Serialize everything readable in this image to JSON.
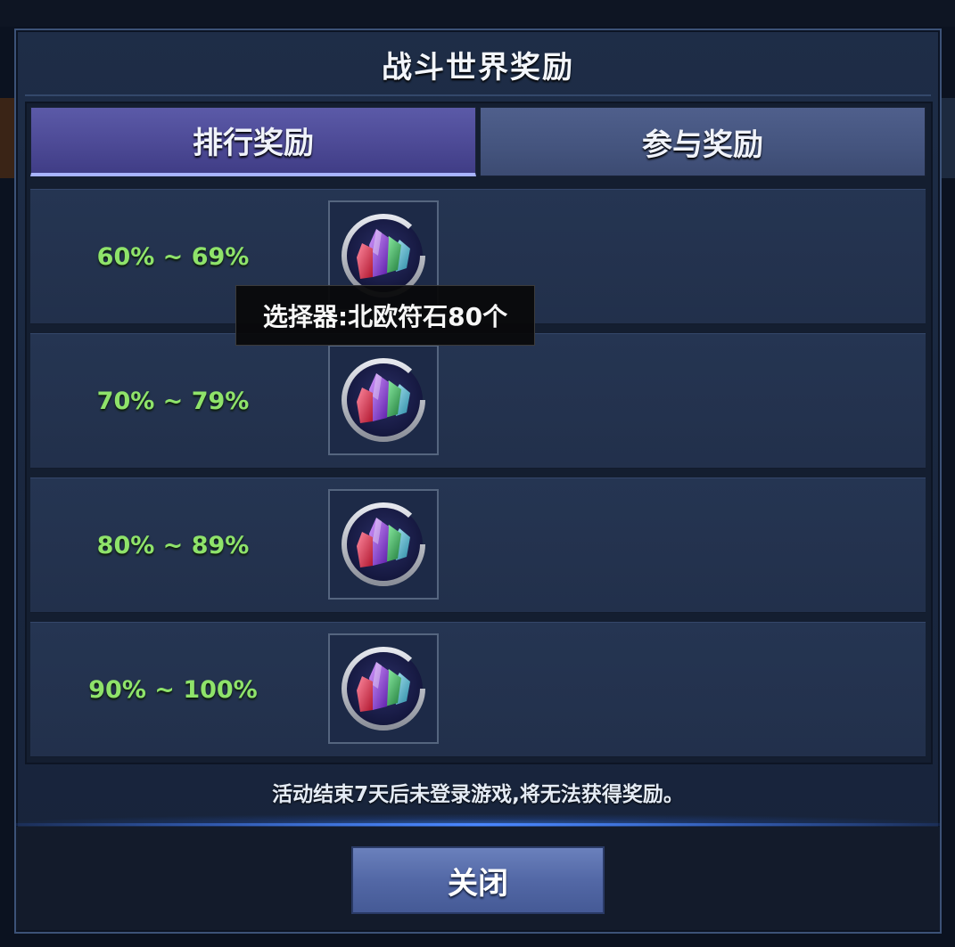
{
  "dialog": {
    "title": "战斗世界奖励",
    "tabs": [
      {
        "label": "排行奖励",
        "active": true
      },
      {
        "label": "参与奖励",
        "active": false
      }
    ],
    "rewards": [
      {
        "range": "60% ~ 69%",
        "item_icon": "rune-crystals-icon"
      },
      {
        "range": "70% ~ 79%",
        "item_icon": "rune-crystals-icon"
      },
      {
        "range": "80% ~ 89%",
        "item_icon": "rune-crystals-icon"
      },
      {
        "range": "90% ~ 100%",
        "item_icon": "rune-crystals-icon"
      }
    ],
    "tooltip": "选择器:北欧符石80个",
    "notice": "活动结束7天后未登录游戏,将无法获得奖励。",
    "close_label": "关闭"
  },
  "colors": {
    "range_text": "#8fe36a",
    "active_tab": "#4d4a96",
    "inactive_tab": "#45557f",
    "close_button": "#5368a6"
  }
}
